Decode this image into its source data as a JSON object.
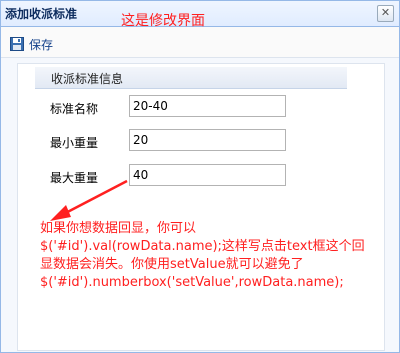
{
  "dialog": {
    "title": "添加收派标准",
    "close_icon_glyph": "✕"
  },
  "annotation_top": "这是修改界面",
  "toolbar": {
    "save_label": "保存",
    "save_icon": "floppy-disk-icon"
  },
  "form": {
    "section_title": "收派标准信息",
    "fields": [
      {
        "label": "标准名称",
        "value": "20-40"
      },
      {
        "label": "最小重量",
        "value": "20"
      },
      {
        "label": "最大重量",
        "value": "40"
      }
    ]
  },
  "annotation_main": "如果你想数据回显，你可以\n$('#id').val(rowData.name);这样写点击text框这个回\n显数据会消失。你使用setValue就可以避免了\n$('#id').numberbox('setValue',rowData.name);",
  "colors": {
    "annotation": "#ff2020",
    "border": "#95b8e7",
    "title_text": "#0e2d5f"
  }
}
